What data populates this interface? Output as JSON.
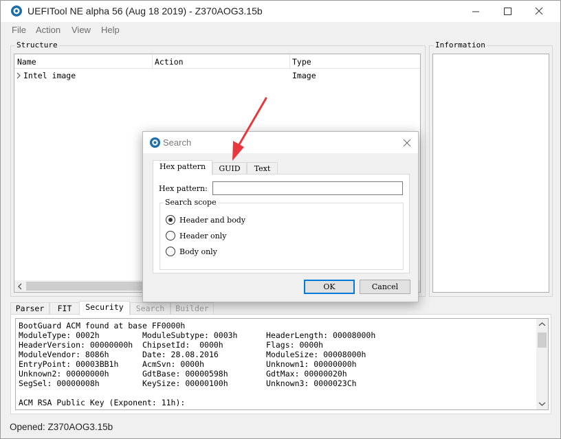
{
  "window": {
    "title": "UEFITool NE alpha 56 (Aug 18 2019) - Z370AOG3.15b"
  },
  "menu": [
    "File",
    "Action",
    "View",
    "Help"
  ],
  "structure": {
    "label": "Structure",
    "columns": [
      "Name",
      "Action",
      "Type"
    ],
    "rows": [
      {
        "name": "Intel image",
        "action": "",
        "type": "Image"
      }
    ]
  },
  "information": {
    "label": "Information"
  },
  "bottom_tabs": [
    {
      "label": "Parser",
      "state": "normal"
    },
    {
      "label": "FIT",
      "state": "normal"
    },
    {
      "label": "Security",
      "state": "active"
    },
    {
      "label": "Search",
      "state": "disabled"
    },
    {
      "label": "Builder",
      "state": "disabled"
    }
  ],
  "log": [
    "BootGuard ACM found at base FF0000h",
    "ModuleType: 0002h         ModuleSubtype: 0003h      HeaderLength: 00008000h",
    "HeaderVersion: 00000000h  ChipsetId:  0000h         Flags: 0000h",
    "ModuleVendor: 8086h       Date: 28.08.2016          ModuleSize: 00008000h",
    "EntryPoint: 00003BB1h     AcmSvn: 0000h             Unknown1: 00000000h",
    "Unknown2: 00000000h       GdtBase: 00000598h        GdtMax: 00000020h",
    "SegSel: 00000008h         KeySize: 00000100h        Unknown3: 0000023Ch",
    "",
    "ACM RSA Public Key (Exponent: 11h):"
  ],
  "status": {
    "text": "Opened: Z370AOG3.15b"
  },
  "search_dialog": {
    "title": "Search",
    "tabs": [
      "Hex pattern",
      "GUID",
      "Text"
    ],
    "hex_label": "Hex pattern:",
    "hex_value": "",
    "scope_label": "Search scope",
    "options": [
      "Header and body",
      "Header only",
      "Body only"
    ],
    "selected_option": "Header and body",
    "ok_label": "OK",
    "cancel_label": "Cancel"
  },
  "colors": {
    "annotation_arrow": "#e8383d",
    "focus_border": "#0078d7"
  },
  "icons": [
    "app-icon",
    "minimize-icon",
    "maximize-icon",
    "close-icon",
    "expand-arrow-icon",
    "scroll-left-icon",
    "scroll-up-icon",
    "scroll-down-icon"
  ]
}
